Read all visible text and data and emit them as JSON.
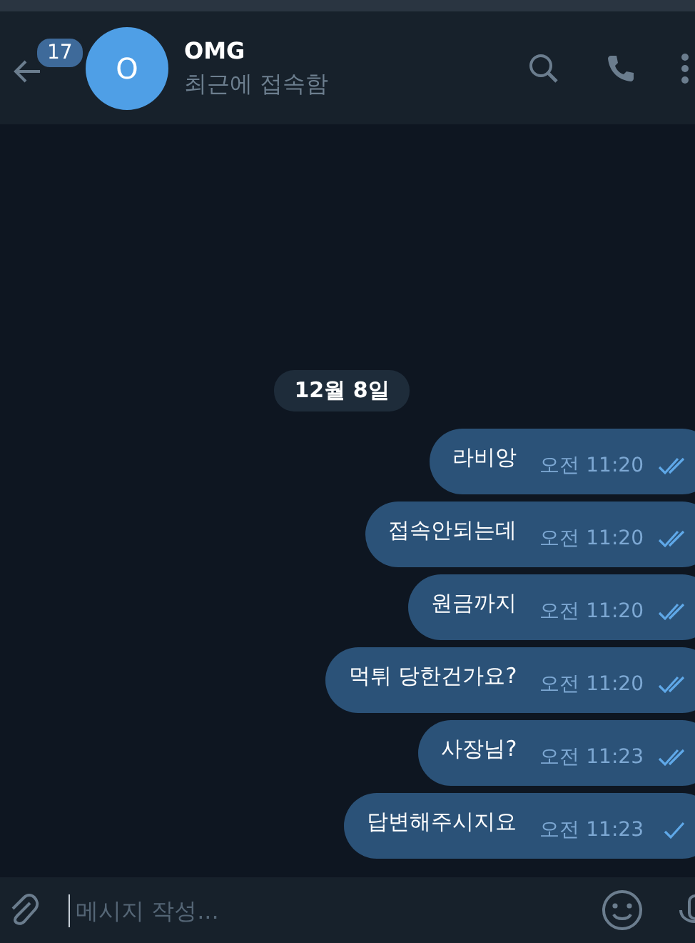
{
  "header": {
    "unread_count": "17",
    "avatar_letter": "O",
    "title": "OMG",
    "status": "최근에 접속함"
  },
  "date_label": "12월 8일",
  "messages": [
    {
      "text": "라비앙",
      "time": "오전 11:20",
      "read": true
    },
    {
      "text": "접속안되는데",
      "time": "오전 11:20",
      "read": true
    },
    {
      "text": "원금까지",
      "time": "오전 11:20",
      "read": true
    },
    {
      "text": "먹튀 당한건가요?",
      "time": "오전 11:20",
      "read": true
    },
    {
      "text": "사장님?",
      "time": "오전 11:23",
      "read": true
    },
    {
      "text": "답변해주시지요",
      "time": "오전 11:23",
      "read": false
    }
  ],
  "composer": {
    "placeholder": "메시지 작성..."
  }
}
